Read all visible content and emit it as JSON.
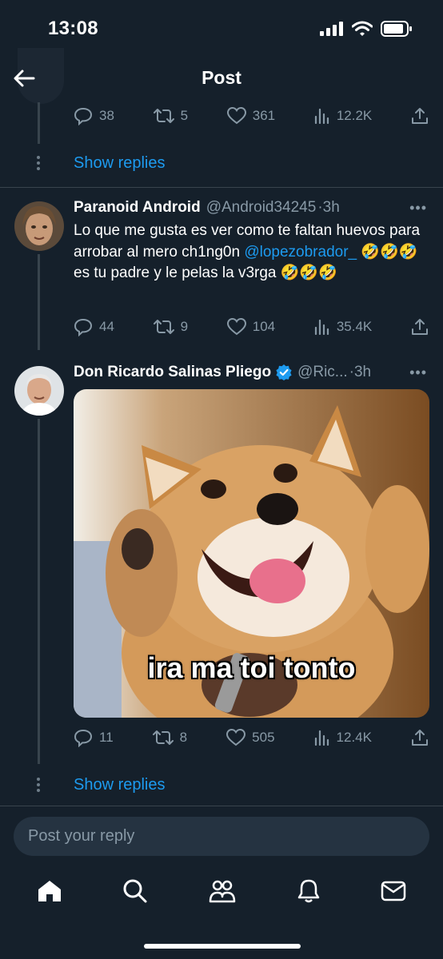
{
  "status_bar": {
    "time": "13:08"
  },
  "header": {
    "title": "Post"
  },
  "thread": {
    "top_stats": {
      "replies": "38",
      "reposts": "5",
      "likes": "361",
      "views": "12.2K"
    },
    "show_replies_1": "Show replies",
    "tweets": [
      {
        "name": "Paranoid Android",
        "handle": "@Android34245",
        "time": "·3h",
        "text_1": "Lo que me gusta es ver como te faltan huevos para arrobar al mero ch1ng0n ",
        "mention": "@lopezobrador_",
        "text_2": " 🤣🤣🤣 es tu padre y le pelas la v3rga 🤣🤣🤣",
        "stats": {
          "replies": "44",
          "reposts": "9",
          "likes": "104",
          "views": "35.4K"
        }
      },
      {
        "name": "Don Ricardo Salinas Pliego",
        "handle": "@Ric...",
        "time": "·3h",
        "media_caption": "ira ma toi tonto",
        "stats": {
          "replies": "11",
          "reposts": "8",
          "likes": "505",
          "views": "12.4K"
        }
      }
    ],
    "show_replies_2": "Show replies"
  },
  "reply": {
    "placeholder": "Post your reply"
  },
  "colors": {
    "background": "#15202b",
    "accent": "#1d9bf0",
    "muted": "#8899a6",
    "divider": "#38444d"
  },
  "icons": [
    "back-arrow-icon",
    "reply-icon",
    "repost-icon",
    "like-icon",
    "views-icon",
    "share-icon",
    "more-icon",
    "verified-icon",
    "home-icon",
    "search-icon",
    "communities-icon",
    "notifications-icon",
    "messages-icon"
  ]
}
